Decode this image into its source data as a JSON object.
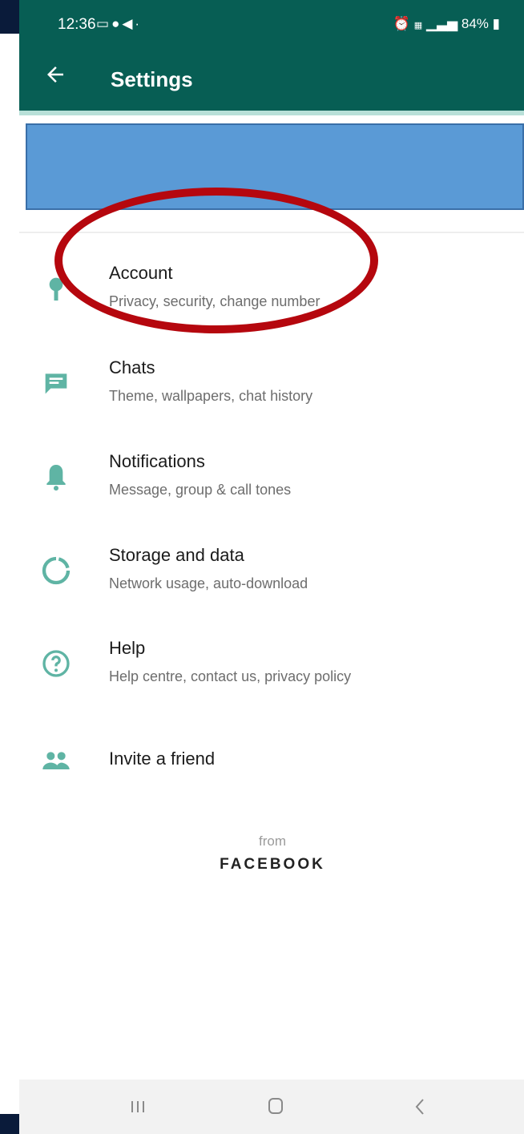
{
  "status_bar": {
    "time": "12:36",
    "left_icons": [
      "cast-icon",
      "swiggy-icon",
      "telegram-icon",
      "dot-icon"
    ],
    "right_text": "84%",
    "right_icons": [
      "alarm-icon",
      "volte-icon",
      "signal-icon",
      "battery-icon"
    ]
  },
  "app_bar": {
    "title": "Settings",
    "back_icon": "arrow-left-icon",
    "color": "#075e54"
  },
  "profile_banner_color": "#5a9ad6",
  "annotation_color": "#b5070e",
  "settings_items": [
    {
      "title": "Account",
      "subtitle": "Privacy, security, change number",
      "icon": "key-icon"
    },
    {
      "title": "Chats",
      "subtitle": "Theme, wallpapers, chat history",
      "icon": "chat-icon"
    },
    {
      "title": "Notifications",
      "subtitle": "Message, group & call tones",
      "icon": "bell-icon"
    },
    {
      "title": "Storage and data",
      "subtitle": "Network usage, auto-download",
      "icon": "storage-icon"
    },
    {
      "title": "Help",
      "subtitle": "Help centre, contact us, privacy policy",
      "icon": "help-icon"
    },
    {
      "title": "Invite a friend",
      "subtitle": "",
      "icon": "people-icon"
    }
  ],
  "footer": {
    "from_label": "from",
    "brand": "FACEBOOK"
  },
  "nav_bar": {
    "buttons": [
      "recents-icon",
      "home-icon",
      "back-icon"
    ]
  },
  "icon_color": "#5fb4a4"
}
